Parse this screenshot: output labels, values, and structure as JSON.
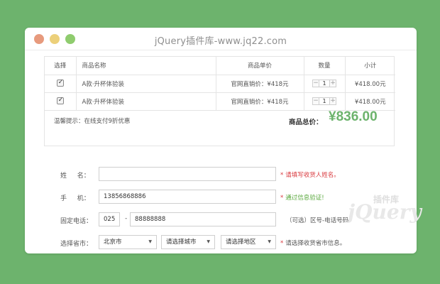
{
  "window": {
    "title": "jQuery插件库-www.jq22.com"
  },
  "cart": {
    "headers": {
      "select": "选择",
      "name": "商品名称",
      "price": "商品单价",
      "qty": "数量",
      "subtotal": "小计"
    },
    "rows": [
      {
        "checked": true,
        "name": "A款·升杯体验装",
        "price": "官网直销价：¥418元",
        "qty": "1",
        "minus": "−",
        "plus": "+",
        "subtotal": "¥418.00元"
      },
      {
        "checked": true,
        "name": "A款·升杯体验装",
        "price": "官网直销价：¥418元",
        "qty": "1",
        "minus": "−",
        "plus": "+",
        "subtotal": "¥418.00元"
      }
    ],
    "tip": "温馨提示：在线支付9折优惠",
    "total_label": "商品总价：",
    "total_value": "¥836.00"
  },
  "form": {
    "name": {
      "label": "姓　  名：",
      "value": "",
      "hint": "请填写收货人姓名。"
    },
    "phone": {
      "label": "手　  机：",
      "value": "13856868886",
      "hint": "通过信息验证!"
    },
    "landline": {
      "label": "固定电话：",
      "area": "025",
      "number": "88888888",
      "dash": "-",
      "hint": "（可选）区号-电话号码"
    },
    "region": {
      "label": "选择省市：",
      "province": "北京市",
      "city": "请选择城市",
      "district": "请选择地区",
      "hint": "请选择收货省市信息。"
    },
    "star": "*"
  },
  "watermark": {
    "text": "jQuery",
    "small": "插件库"
  },
  "colors": {
    "background": "#6db36d",
    "accent": "#6db36d",
    "error": "#d9393e",
    "success": "#59a83c"
  }
}
